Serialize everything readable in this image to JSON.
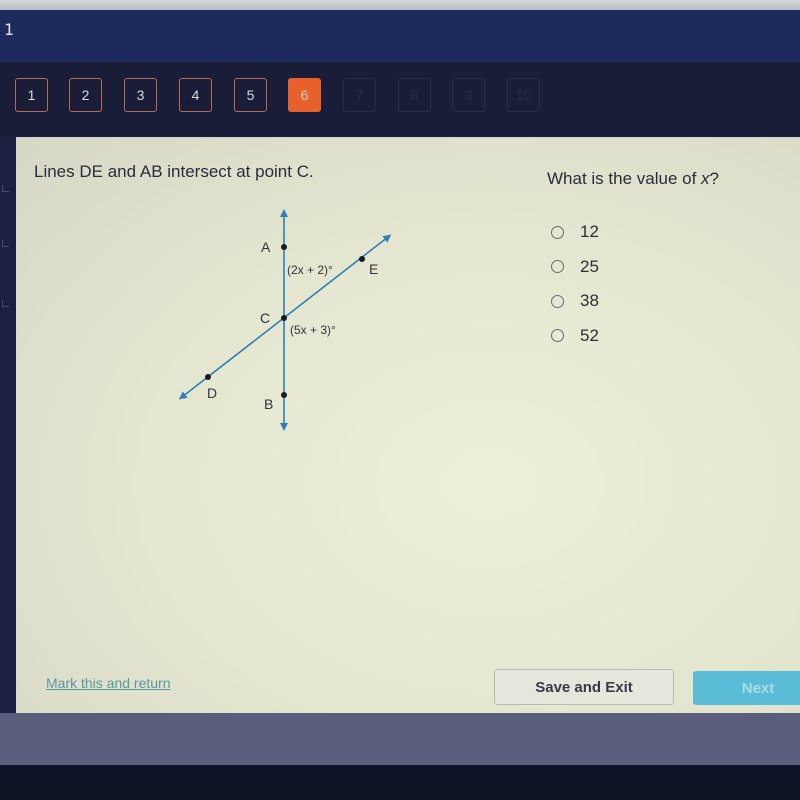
{
  "header": {
    "page_number": "1"
  },
  "question_nav": {
    "buttons": [
      {
        "label": "1",
        "state": "visited"
      },
      {
        "label": "2",
        "state": "visited"
      },
      {
        "label": "3",
        "state": "visited"
      },
      {
        "label": "4",
        "state": "visited"
      },
      {
        "label": "5",
        "state": "visited"
      },
      {
        "label": "6",
        "state": "current"
      },
      {
        "label": "7",
        "state": "unvisited"
      },
      {
        "label": "8",
        "state": "unvisited"
      },
      {
        "label": "9",
        "state": "unvisited"
      },
      {
        "label": "10",
        "state": "unvisited"
      }
    ],
    "active_color": "#e8602c"
  },
  "content": {
    "stem": "Lines DE and AB intersect at point C.",
    "question_prefix": "What is the value of ",
    "question_variable": "x",
    "question_suffix": "?",
    "options": [
      {
        "label": "12",
        "selected": false
      },
      {
        "label": "25",
        "selected": false
      },
      {
        "label": "38",
        "selected": false
      },
      {
        "label": "52",
        "selected": false
      }
    ],
    "diagram": {
      "point_labels": {
        "A": "A",
        "B": "B",
        "C": "C",
        "D": "D",
        "E": "E"
      },
      "angle_top": "(2x + 2)°",
      "angle_bottom": "(5x + 3)°",
      "line_color": "#2f7fb8"
    }
  },
  "footer": {
    "mark_link": "Mark this and return",
    "save_button": "Save and Exit",
    "next_button": "Next",
    "next_color": "#5abcd6"
  }
}
